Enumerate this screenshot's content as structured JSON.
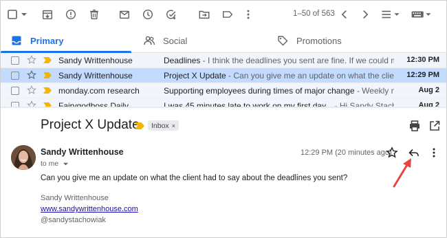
{
  "toolbar": {
    "icons": [
      "checkbox-icon",
      "archive-icon",
      "report-spam-icon",
      "delete-icon",
      "mark-unread-icon",
      "snooze-icon",
      "add-task-icon",
      "move-to-icon",
      "label-icon",
      "more-vert-icon"
    ],
    "pager_text": "1–50 of 563"
  },
  "tabs": [
    {
      "label": "Primary",
      "icon": "inbox-icon",
      "active": true
    },
    {
      "label": "Social",
      "icon": "people-icon",
      "active": false
    },
    {
      "label": "Promotions",
      "icon": "tag-icon",
      "active": false
    }
  ],
  "emails": [
    {
      "sender": "Sandy Writtenhouse",
      "subject": "Deadlines",
      "snippet": " - I think the deadlines you sent are fine. If we could mo...",
      "date": "12:30 PM"
    },
    {
      "sender": "Sandy Writtenhouse",
      "subject": "Project X Update",
      "snippet": " - Can you give me an update on what the client ...",
      "date": "12:29 PM"
    },
    {
      "sender": "monday.com research",
      "subject": "Supporting employees during times of major change",
      "snippet": " - Weekly ne...",
      "date": "Aug 2"
    },
    {
      "sender": "Fairygodboss Daily",
      "subject": "I was 45 minutes late to work on my first day...",
      "snippet": " - Hi Sandy Stachowi...",
      "date": "Aug 2"
    }
  ],
  "message": {
    "subject": "Project X Update",
    "label_chip": "Inbox",
    "label_chip_remove": "×",
    "sender_name": "Sandy Writtenhouse",
    "recipient": "to me",
    "timestamp": "12:29 PM (20 minutes ago)",
    "body": "Can you give me an update on what the client had to say about the deadlines you sent?",
    "signature_name": "Sandy Writtenhouse",
    "signature_link": "www.sandywrittenhouse.com",
    "signature_handle": "@sandystachowiak"
  },
  "colors": {
    "accent": "#1a73e8",
    "important": "#f5b400",
    "selected_row": "#c2dbff",
    "annotation_arrow": "#e8453c"
  }
}
